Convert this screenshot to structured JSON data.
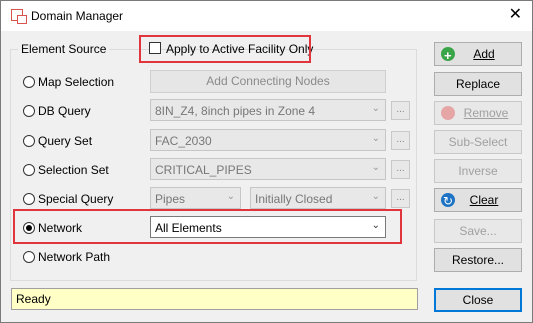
{
  "window": {
    "title": "Domain Manager",
    "close_glyph": "✕"
  },
  "element_source": {
    "group_label": "Element Source",
    "apply_checkbox": {
      "label": "Apply to Active Facility Only",
      "checked": false
    },
    "options": [
      {
        "label": "Map Selection",
        "checked": false,
        "control": "Add Connecting Nodes"
      },
      {
        "label": "DB Query",
        "checked": false,
        "control": "8IN_Z4, 8inch pipes in Zone 4"
      },
      {
        "label": "Query Set",
        "checked": false,
        "control": "FAC_2030"
      },
      {
        "label": "Selection Set",
        "checked": false,
        "control": "CRITICAL_PIPES"
      },
      {
        "label": "Special Query",
        "checked": false,
        "control": "Pipes",
        "control2": "Initially Closed"
      },
      {
        "label": "Network",
        "checked": true,
        "control": "All Elements"
      },
      {
        "label": "Network Path",
        "checked": false
      }
    ],
    "ellipsis_label": "..."
  },
  "status": {
    "text": "Ready"
  },
  "buttons": {
    "add": "Add",
    "replace": "Replace",
    "remove": "Remove",
    "sub_select": "Sub-Select",
    "inverse": "Inverse",
    "clear": "Clear",
    "save": "Save...",
    "restore": "Restore...",
    "close": "Close"
  },
  "colors": {
    "highlight": "#e0353c",
    "status_bg": "#ffffc6",
    "accent": "#0078d7"
  }
}
